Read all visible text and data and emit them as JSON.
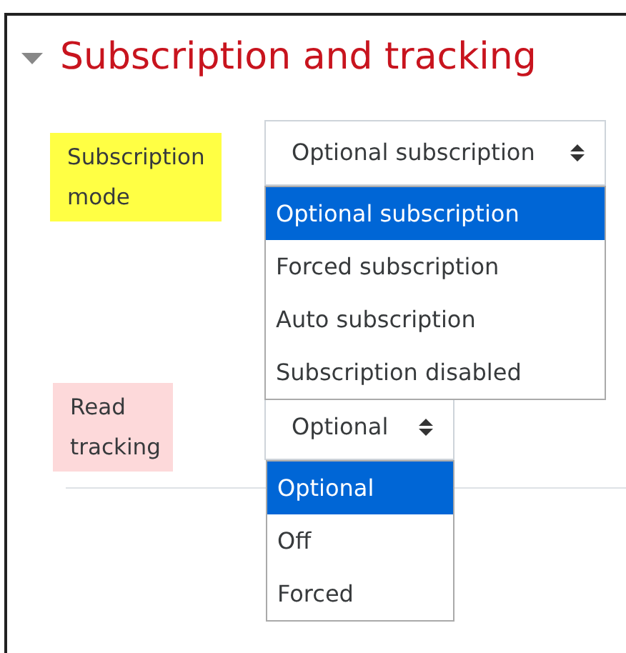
{
  "section": {
    "title": "Subscription and tracking",
    "expanded": true
  },
  "fields": [
    {
      "label": "Subscription mode",
      "color": "#ffff44",
      "value": "Optional subscription",
      "options": [
        {
          "label": "Optional subscription",
          "selected": true
        },
        {
          "label": "Forced subscription",
          "selected": false
        },
        {
          "label": "Auto subscription",
          "selected": false
        },
        {
          "label": "Subscription disabled",
          "selected": false
        }
      ]
    },
    {
      "label": "Read tracking",
      "color": "#fdd9da",
      "value": "Optional",
      "options": [
        {
          "label": "Optional",
          "selected": true
        },
        {
          "label": "Off",
          "selected": false
        },
        {
          "label": "Forced",
          "selected": false
        }
      ]
    }
  ]
}
